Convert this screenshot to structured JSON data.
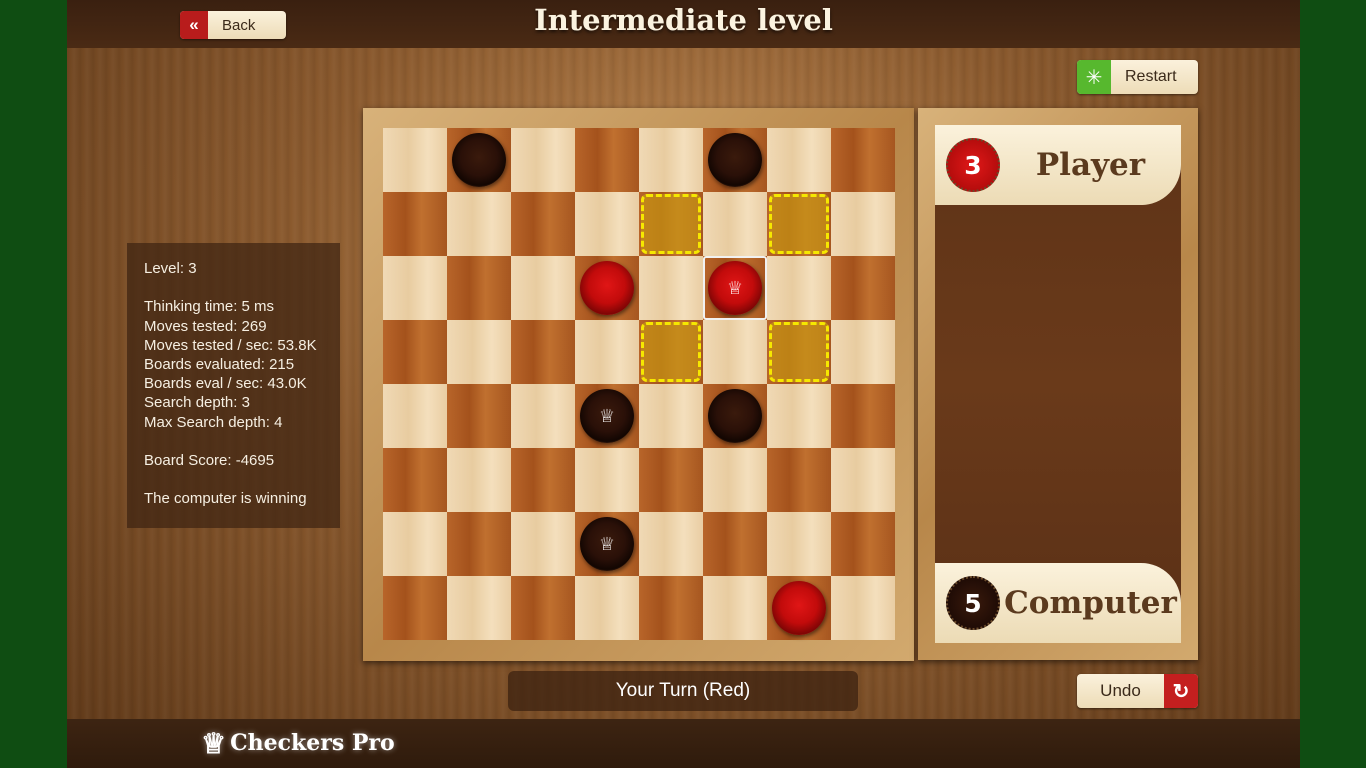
{
  "header": {
    "title": "Intermediate level",
    "back_label": "Back",
    "back_icon": "double-chevron-left-icon"
  },
  "toolbar": {
    "restart_label": "Restart",
    "restart_icon": "loading-spinner-icon",
    "undo_label": "Undo",
    "undo_icon": "undo-arrow-icon"
  },
  "stats": {
    "level": "Level: 3",
    "thinking_time": "Thinking time: 5 ms",
    "moves_tested": "Moves tested: 269",
    "moves_per_sec": "Moves tested / sec: 53.8K",
    "boards_evaluated": "Boards evaluated: 215",
    "boards_per_sec": "Boards eval / sec: 43.0K",
    "search_depth": "Search depth: 3",
    "max_search_depth": "Max Search depth: 4",
    "board_score": "Board Score: -4695",
    "verdict": "The computer is winning"
  },
  "board": {
    "size": 8,
    "top_left_color": "light",
    "pieces": [
      {
        "row": 0,
        "col": 1,
        "color": "black",
        "king": false
      },
      {
        "row": 0,
        "col": 5,
        "color": "black",
        "king": false
      },
      {
        "row": 2,
        "col": 3,
        "color": "red",
        "king": false
      },
      {
        "row": 2,
        "col": 5,
        "color": "red",
        "king": true
      },
      {
        "row": 4,
        "col": 3,
        "color": "black",
        "king": true
      },
      {
        "row": 4,
        "col": 5,
        "color": "black",
        "king": false
      },
      {
        "row": 6,
        "col": 3,
        "color": "black",
        "king": true
      },
      {
        "row": 7,
        "col": 6,
        "color": "red",
        "king": false
      }
    ],
    "selected": {
      "row": 2,
      "col": 5
    },
    "move_targets": [
      {
        "row": 1,
        "col": 4
      },
      {
        "row": 1,
        "col": 6
      },
      {
        "row": 3,
        "col": 4
      },
      {
        "row": 3,
        "col": 6
      }
    ],
    "king_symbol": "♕"
  },
  "scoreboard": {
    "player": {
      "name": "Player",
      "count": "3",
      "color": "red"
    },
    "computer": {
      "name": "Computer",
      "count": "5",
      "color": "black"
    }
  },
  "status": {
    "turn": "Your Turn (Red)"
  },
  "footer": {
    "logo_text": "Checkers Pro",
    "logo_icon": "crown-icon"
  }
}
